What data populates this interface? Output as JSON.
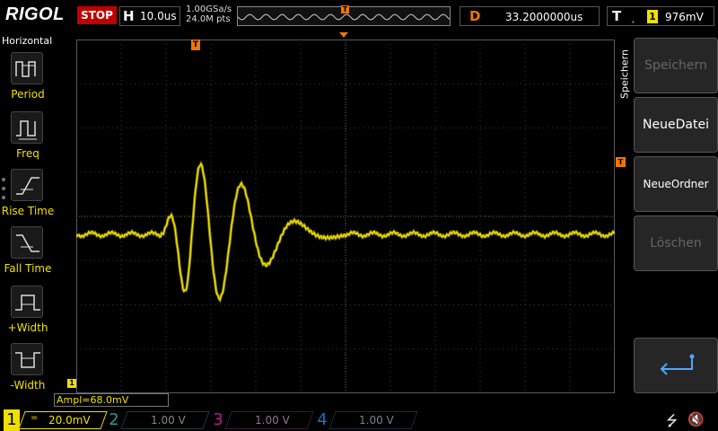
{
  "header": {
    "logo": "RIGOL",
    "run_state": "STOP",
    "timebase_letter": "H",
    "timebase": "10.0us",
    "sample_rate": "1.00GSa/s",
    "memory_depth": "24.0M pts",
    "delay_letter": "D",
    "delay": "33.2000000us",
    "trigger_letter": "T",
    "trigger_channel": "1",
    "trigger_level": "976mV"
  },
  "left_panel": {
    "title": "Horizontal",
    "measurements": [
      {
        "label": "Period",
        "icon": "period-icon"
      },
      {
        "label": "Freq",
        "icon": "frequency-icon"
      },
      {
        "label": "Rise Time",
        "icon": "rise-time-icon"
      },
      {
        "label": "Fall Time",
        "icon": "fall-time-icon"
      },
      {
        "label": "+Width",
        "icon": "positive-width-icon"
      },
      {
        "label": "-Width",
        "icon": "negative-width-icon"
      }
    ]
  },
  "markers": {
    "trigger_position": "T",
    "channel1_offset": "1",
    "trigger_level": "T"
  },
  "measurement_result": "Ampl=68.0mV",
  "right_menu": {
    "title": "Speichern",
    "buttons": [
      {
        "label": "Speichern",
        "enabled": false
      },
      {
        "label": "NeueDatei",
        "enabled": true
      },
      {
        "label": "NeueOrdner",
        "enabled": true
      },
      {
        "label": "Löschen",
        "enabled": false
      }
    ],
    "back_icon": "return-arrow-icon"
  },
  "channels": [
    {
      "number": "1",
      "coupling": "=",
      "scale": "20.0mV",
      "color": "#f0e000",
      "active": true
    },
    {
      "number": "2",
      "coupling": "",
      "scale": "1.00 V",
      "color": "#22a090",
      "active": false
    },
    {
      "number": "3",
      "coupling": "",
      "scale": "1.00 V",
      "color": "#b0208c",
      "active": false
    },
    {
      "number": "4",
      "coupling": "",
      "scale": "1.00 V",
      "color": "#1c6ec8",
      "active": false
    }
  ],
  "status_icons": [
    "usb-icon",
    "speaker-muted-icon"
  ],
  "colors": {
    "trace": "#f0e000",
    "trigger": "#f07800",
    "stop": "#c00000"
  }
}
